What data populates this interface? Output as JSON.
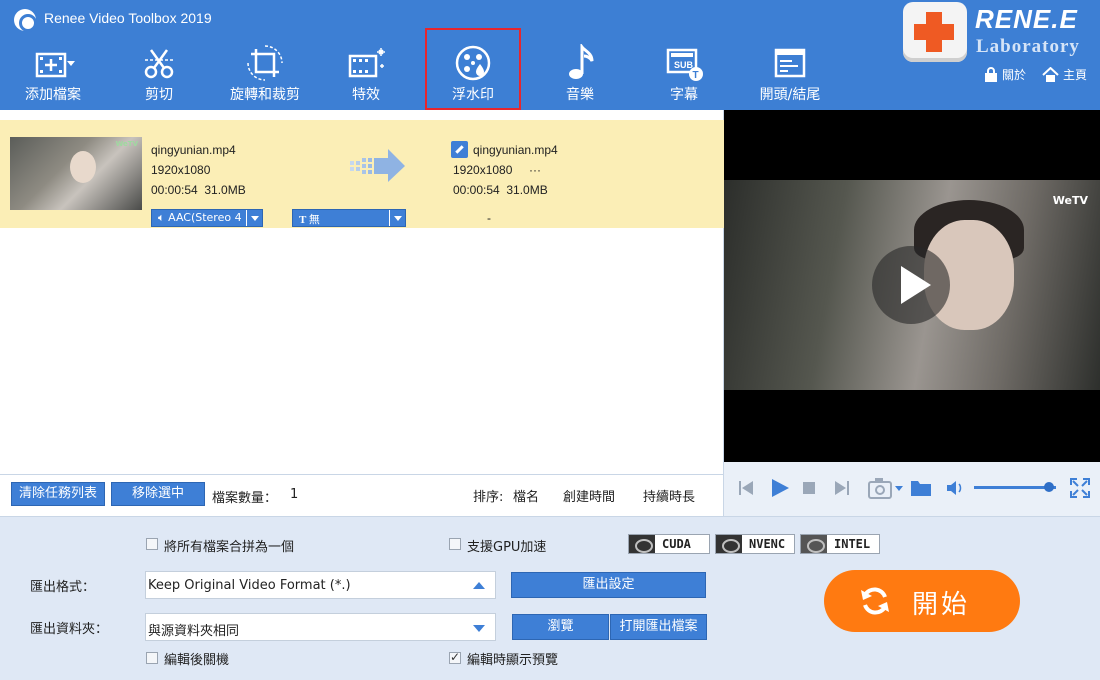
{
  "app": {
    "title": "Renee Video Toolbox 2019"
  },
  "brand": {
    "top": "RENE.E",
    "bottom": "Laboratory"
  },
  "toolbar": [
    {
      "label": "添加檔案",
      "icon": "add-file-icon"
    },
    {
      "label": "剪切",
      "icon": "scissors-icon"
    },
    {
      "label": "旋轉和裁剪",
      "icon": "crop-rotate-icon"
    },
    {
      "label": "特效",
      "icon": "effects-film-icon"
    },
    {
      "label": "浮水印",
      "icon": "watermark-icon",
      "selected": true
    },
    {
      "label": "音樂",
      "icon": "music-note-icon"
    },
    {
      "label": "字幕",
      "icon": "subtitle-icon"
    },
    {
      "label": "開頭/結尾",
      "icon": "intro-outro-icon"
    }
  ],
  "top_links": {
    "about": "關於",
    "home": "主頁"
  },
  "task": {
    "source": {
      "name": "qingyunian.mp4",
      "resolution": "1920x1080",
      "duration_size": "00:00:54  31.0MB"
    },
    "output": {
      "name": "qingyunian.mp4",
      "resolution": "1920x1080",
      "more": "···",
      "duration_size": "00:00:54  31.0MB"
    },
    "audio_select": "AAC(Stereo 4",
    "subtitle_select": "無",
    "output_dash": "-",
    "thumb_mark": "WeTV"
  },
  "list_bar": {
    "clear_label": "清除任務列表",
    "remove_label": "移除選中",
    "count_label": "檔案數量：",
    "count_value": "1",
    "sort_label": "排序:",
    "sort_name": "檔名",
    "sort_created": "創建時間",
    "sort_duration": "持續時長"
  },
  "preview": {
    "watermark": "WeTV",
    "volume_pct": 92
  },
  "settings": {
    "merge_label": "將所有檔案合拼為一個",
    "gpu_label": "支援GPU加速",
    "accel": [
      "CUDA",
      "NVENC",
      "INTEL"
    ],
    "format_label": "匯出格式：",
    "format_value": "Keep Original Video Format (*.)",
    "export_settings_btn": "匯出設定",
    "folder_label": "匯出資料夾：",
    "folder_value": "與源資料夾相同",
    "browse_btn": "瀏覽",
    "open_folder_btn": "打開匯出檔案",
    "shutdown_label": "編輯後關機",
    "preview_label": "編輯時顯示預覽",
    "preview_checked": true
  },
  "start": {
    "label": "開始"
  },
  "colors": {
    "header": "#3d7fd4",
    "button": "#3e7fd6",
    "start": "#ff7a11",
    "selected_row": "#fbeeb6",
    "highlight_box": "#e8262c"
  }
}
